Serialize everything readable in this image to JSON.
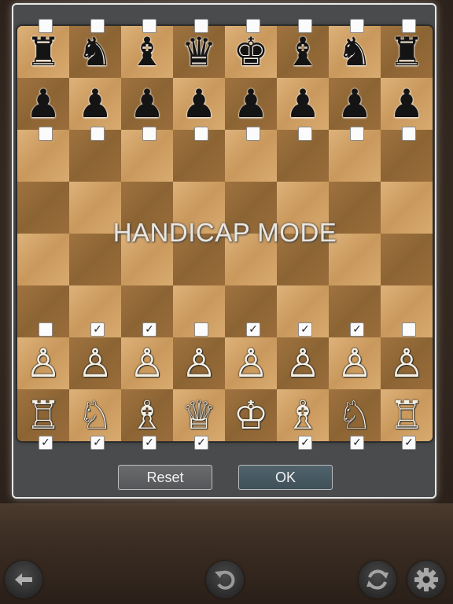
{
  "board": {
    "watermark": "HANDICAP MODE",
    "black_back_rank": [
      "rook",
      "knight",
      "bishop",
      "queen",
      "king",
      "bishop",
      "knight",
      "rook"
    ],
    "black_pawns": [
      "pawn",
      "pawn",
      "pawn",
      "pawn",
      "pawn",
      "pawn",
      "pawn",
      "pawn"
    ],
    "white_pawns": [
      "pawn",
      "pawn",
      "pawn",
      "pawn",
      "pawn",
      "pawn",
      "pawn",
      "pawn"
    ],
    "white_back_rank": [
      "rook",
      "knight",
      "bishop",
      "queen",
      "king",
      "bishop",
      "knight",
      "rook"
    ],
    "glyphs": {
      "black": {
        "rook": "♜",
        "knight": "♞",
        "bishop": "♝",
        "queen": "♛",
        "king": "♚",
        "pawn": "♟"
      },
      "white": {
        "rook": "♖",
        "knight": "♘",
        "bishop": "♗",
        "queen": "♕",
        "king": "♔",
        "pawn": "♙"
      }
    },
    "light_color": "#ddb27a",
    "dark_color": "#9f7340"
  },
  "checkboxes": {
    "black_back_rank": [
      false,
      false,
      false,
      false,
      false,
      false,
      false,
      false
    ],
    "black_pawns": [
      false,
      false,
      false,
      false,
      false,
      false,
      false,
      false
    ],
    "white_pawns": [
      false,
      true,
      true,
      false,
      true,
      true,
      true,
      false
    ],
    "white_back_rank": [
      true,
      true,
      true,
      true,
      null,
      true,
      true,
      true
    ]
  },
  "dialog": {
    "reset_label": "Reset",
    "ok_label": "OK"
  },
  "toolbar": {
    "back_icon": "arrow-left-icon",
    "undo_icon": "undo-icon",
    "rotate_icon": "rotate-board-icon",
    "settings_icon": "gear-icon"
  }
}
